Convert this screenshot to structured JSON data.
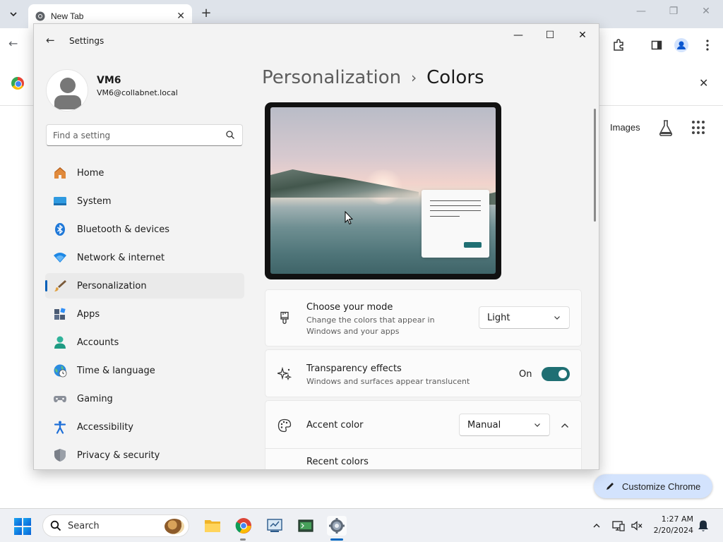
{
  "browser": {
    "tab_title": "New Tab",
    "ntp_images_label": "Images",
    "customize_chrome_label": "Customize Chrome"
  },
  "settings": {
    "window_title": "Settings",
    "profile": {
      "name": "VM6",
      "email": "VM6@collabnet.local"
    },
    "search_placeholder": "Find a setting",
    "nav_items": [
      {
        "label": "Home",
        "icon": "home-icon"
      },
      {
        "label": "System",
        "icon": "system-icon"
      },
      {
        "label": "Bluetooth & devices",
        "icon": "bluetooth-icon"
      },
      {
        "label": "Network & internet",
        "icon": "network-icon"
      },
      {
        "label": "Personalization",
        "icon": "personalization-brush-icon",
        "selected": true
      },
      {
        "label": "Apps",
        "icon": "apps-icon"
      },
      {
        "label": "Accounts",
        "icon": "accounts-icon"
      },
      {
        "label": "Time & language",
        "icon": "time-language-icon"
      },
      {
        "label": "Gaming",
        "icon": "gaming-icon"
      },
      {
        "label": "Accessibility",
        "icon": "accessibility-icon"
      },
      {
        "label": "Privacy & security",
        "icon": "privacy-shield-icon"
      }
    ],
    "breadcrumb": {
      "parent": "Personalization",
      "separator": "›",
      "current": "Colors"
    },
    "mode_card": {
      "title": "Choose your mode",
      "description_line1": "Change the colors that appear in",
      "description_line2": "Windows and your apps",
      "value": "Light"
    },
    "transparency_card": {
      "title": "Transparency effects",
      "description": "Windows and surfaces appear translucent",
      "state_label": "On",
      "on": true
    },
    "accent_card": {
      "title": "Accent color",
      "value": "Manual",
      "expanded": true,
      "recent_colors_label": "Recent colors"
    }
  },
  "taskbar": {
    "search_label": "Search",
    "time": "1:27 AM",
    "date": "2/20/2024"
  },
  "colors": {
    "accent": "#1f6f73",
    "selection_indicator": "#005fb8",
    "taskbar_bg": "#eef0f4"
  }
}
